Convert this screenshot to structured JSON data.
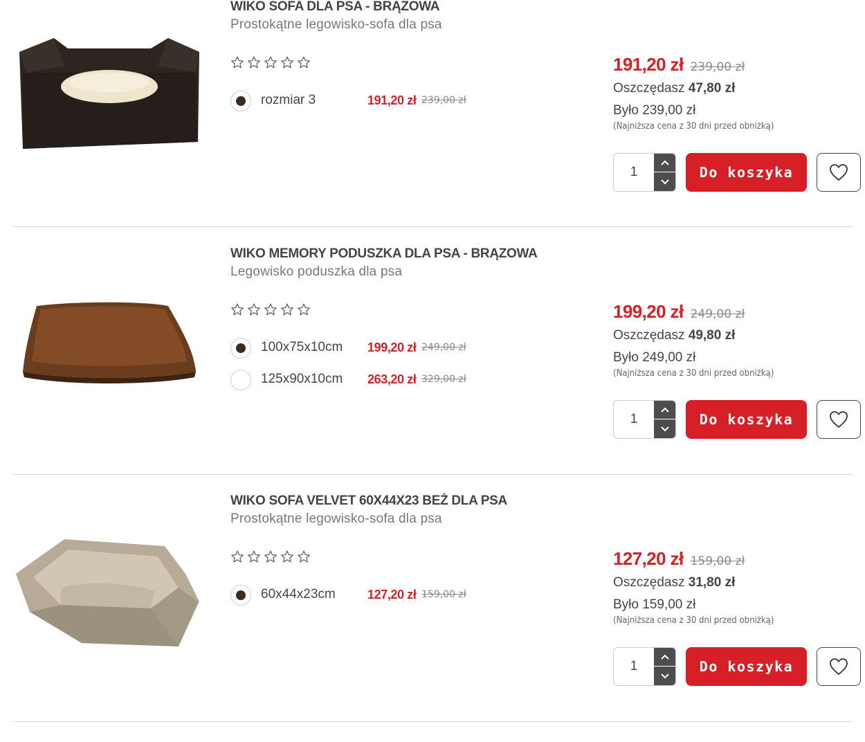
{
  "products": [
    {
      "name": "WIKO SOFA DLA PSA - BRĄZOWA",
      "subtitle": "Prostokątne legowisko-sofa dla psa",
      "rating": 0,
      "variants": [
        {
          "label": "rozmiar 3",
          "price": "191,20 zł",
          "old_price": "239,00 zł",
          "selected": true
        }
      ],
      "price": "191,20 zł",
      "old_price": "239,00 zł",
      "saving_label": "Oszczędasz",
      "saving_value": "47,80 zł",
      "was": "Było 239,00 zł",
      "lowest_note": "(Najniższa cena z 30 dni przed obniżką)",
      "quantity": "1",
      "cart_label": "Do koszyka",
      "image_icon": "dark-brown-sofa-bed-image"
    },
    {
      "name": "WIKO MEMORY PODUSZKA DLA PSA - BRĄZOWA",
      "subtitle": "Legowisko poduszka dla psa",
      "rating": 0,
      "variants": [
        {
          "label": "100x75x10cm",
          "price": "199,20 zł",
          "old_price": "249,00 zł",
          "selected": true
        },
        {
          "label": "125x90x10cm",
          "price": "263,20 zł",
          "old_price": "329,00 zł",
          "selected": false
        }
      ],
      "price": "199,20 zł",
      "old_price": "249,00 zł",
      "saving_label": "Oszczędasz",
      "saving_value": "49,80 zł",
      "was": "Było 249,00 zł",
      "lowest_note": "(Najniższa cena z 30 dni przed obniżką)",
      "quantity": "1",
      "cart_label": "Do koszyka",
      "image_icon": "brown-cushion-image"
    },
    {
      "name": "WIKO SOFA VELVET 60X44X23 BEŻ DLA PSA",
      "subtitle": "Prostokątne legowisko-sofa dla psa",
      "rating": 0,
      "variants": [
        {
          "label": "60x44x23cm",
          "price": "127,20 zł",
          "old_price": "159,00 zł",
          "selected": true
        }
      ],
      "price": "127,20 zł",
      "old_price": "159,00 zł",
      "saving_label": "Oszczędasz",
      "saving_value": "31,80 zł",
      "was": "Było 159,00 zł",
      "lowest_note": "(Najniższa cena z 30 dni przed obniżką)",
      "quantity": "1",
      "cart_label": "Do koszyka",
      "image_icon": "beige-sofa-bed-image"
    }
  ],
  "colors": {
    "price_red": "#d42027",
    "button_red": "#d61f26",
    "swatch_brown": "#3e2b1f",
    "text_dark": "#444444"
  }
}
